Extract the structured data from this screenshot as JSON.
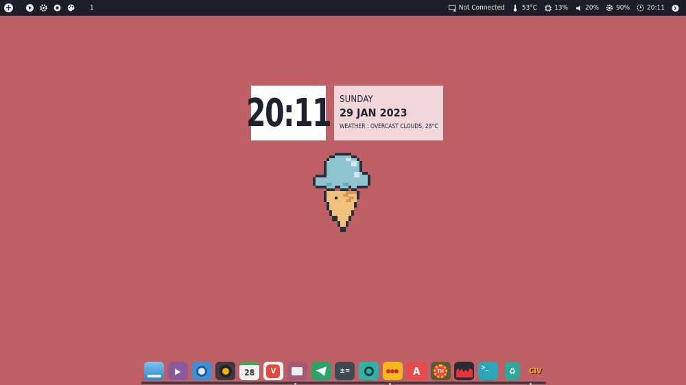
{
  "topbar": {
    "workspace": "1",
    "network": "Not Connected",
    "temperature": "53°C",
    "cpu": "13%",
    "volume": "20%",
    "brightness": "90%",
    "time": "20:11"
  },
  "clock_widget": {
    "time": "20:11",
    "day": "SUNDAY",
    "date": "29 JAN 2023",
    "weather": "WEATHER : OVERCAST CLOUDS, 28°C"
  },
  "dock": {
    "apps": [
      {
        "name": "desktop",
        "label": ""
      },
      {
        "name": "media-player",
        "label": "▶"
      },
      {
        "name": "browser",
        "label": ""
      },
      {
        "name": "music",
        "label": ""
      },
      {
        "name": "calendar",
        "label": "28"
      },
      {
        "name": "vivaldi",
        "label": "V"
      },
      {
        "name": "files",
        "label": ""
      },
      {
        "name": "telegram",
        "label": ""
      },
      {
        "name": "calculator",
        "label": "±="
      },
      {
        "name": "search",
        "label": ""
      },
      {
        "name": "app-yellow",
        "label": ""
      },
      {
        "name": "app-store",
        "label": "A"
      },
      {
        "name": "tweak-tool",
        "label": "TH"
      },
      {
        "name": "equalizer",
        "label": ""
      },
      {
        "name": "terminal",
        "label": ">_"
      },
      {
        "name": "recycle",
        "label": "♻"
      },
      {
        "name": "civ",
        "label": "CIV"
      }
    ]
  },
  "colors": {
    "background": "#bf6067",
    "topbar": "#1c1f29",
    "clock_time_bg": "#ffffff",
    "clock_info_bg": "#f1d7da",
    "text_dark": "#1f2230"
  }
}
